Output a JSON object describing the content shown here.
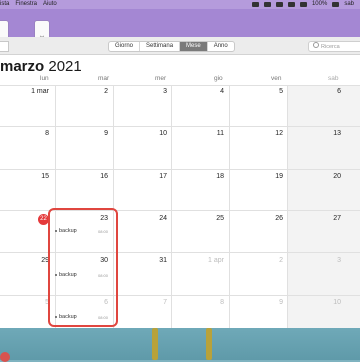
{
  "menubar": {
    "items": [
      "ista",
      "Finestra",
      "Aiuto"
    ],
    "status": {
      "battery": "100%",
      "day": "sab"
    }
  },
  "desktop": {
    "doc_label": "txt"
  },
  "toolbar": {
    "views": [
      "Giorno",
      "Settimana",
      "Mese",
      "Anno"
    ],
    "active_view": "Mese",
    "search_placeholder": "Ricerca"
  },
  "calendar": {
    "month": "marzo",
    "year": "2021",
    "weekdays": [
      "lun",
      "mar",
      "mer",
      "gio",
      "ven",
      "sab"
    ],
    "weeks": [
      [
        "1 mar",
        "2",
        "3",
        "4",
        "5",
        "6"
      ],
      [
        "8",
        "9",
        "10",
        "11",
        "12",
        "13"
      ],
      [
        "15",
        "16",
        "17",
        "18",
        "19",
        "20"
      ],
      [
        "22",
        "23",
        "24",
        "25",
        "26",
        "27"
      ],
      [
        "29",
        "30",
        "31",
        "1 apr",
        "2",
        "3"
      ],
      [
        "5",
        "6",
        "7",
        "8",
        "9",
        "10"
      ]
    ],
    "today_badge": "22",
    "events": [
      {
        "title": "backup",
        "time": "08:00"
      },
      {
        "title": "backup",
        "time": "08:00"
      },
      {
        "title": "backup",
        "time": "08:00"
      }
    ]
  }
}
